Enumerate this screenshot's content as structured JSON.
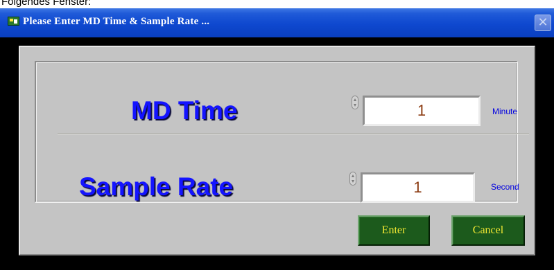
{
  "caption": {
    "text": "Folgendes Fenster:"
  },
  "window": {
    "title": "Please Enter MD Time & Sample Rate ...",
    "close_glyph": "✕",
    "title_icon": "labview-app-icon"
  },
  "form": {
    "md_time": {
      "label": "MD Time",
      "value": "1",
      "unit": "Minute"
    },
    "sample_rate": {
      "label": "Sample Rate",
      "value": "1",
      "unit": "Second"
    }
  },
  "buttons": {
    "enter_label": "Enter",
    "cancel_label": "Cancel"
  },
  "colors": {
    "titlebar": "#0e48cf",
    "panel": "#c4c4c4",
    "label_text": "#1414ff",
    "value_text": "#8b3a10",
    "button_bg": "#1c5a1c",
    "button_text": "#f2e832"
  }
}
